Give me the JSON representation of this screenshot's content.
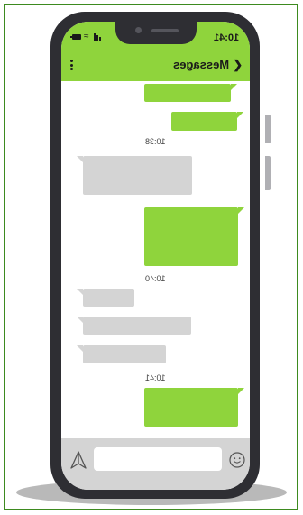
{
  "status_bar": {
    "time": "10:41"
  },
  "header": {
    "title": "Messages",
    "back_glyph": "❮"
  },
  "timestamps": [
    "10:38",
    "10:40",
    "10:41"
  ],
  "icons": {
    "back": "chevron-left-icon",
    "menu": "kebab-menu-icon",
    "send": "send-icon",
    "emoji": "emoji-icon",
    "battery": "battery-icon",
    "wifi": "wifi-icon",
    "signal": "signal-icon"
  },
  "colors": {
    "accent": "#8fd43c",
    "incoming_bubble": "#d4d4d4",
    "phone_body": "#2e2e33",
    "frame_border": "#3d8a1f"
  }
}
